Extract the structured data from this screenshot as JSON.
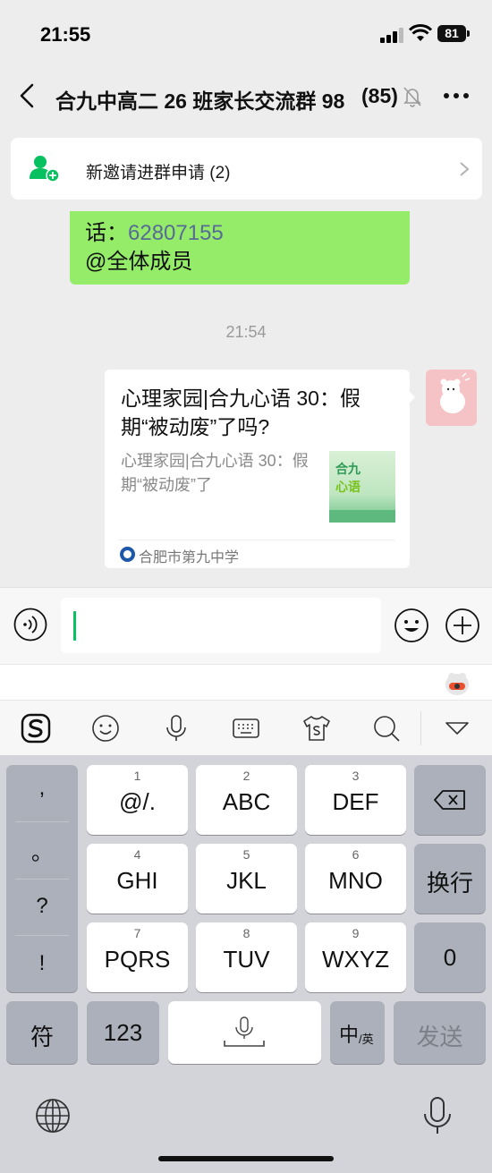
{
  "status_bar": {
    "time": "21:55",
    "battery": "81"
  },
  "nav": {
    "title": "合九中高二 26 班家长交流群 98",
    "member_count": "(85)"
  },
  "invite_banner": {
    "label": "新邀请进群申请 (2)"
  },
  "messages": {
    "previous_bubble": {
      "prefix": "话：",
      "phone": "62807155",
      "mention": "@全体成员"
    },
    "timestamp": "21:54",
    "shared_card": {
      "title": "心理家园|合九心语 30：假期“被动废”了吗?",
      "description": "心理家园|合九心语 30：假期“被动废”了",
      "thumbnail_line1": "合九",
      "thumbnail_line2": "心语",
      "source": "合肥市第九中学"
    }
  },
  "ime": {
    "toolbar_icons": [
      "sogou-logo-icon",
      "emoji-icon",
      "voice-input-icon",
      "keyboard-layout-icon",
      "skin-icon",
      "search-icon",
      "collapse-icon"
    ],
    "punctuation": [
      ",",
      "。",
      "?",
      "!"
    ],
    "keys": [
      {
        "num": "1",
        "label": "@/."
      },
      {
        "num": "2",
        "label": "ABC"
      },
      {
        "num": "3",
        "label": "DEF"
      },
      {
        "num": "4",
        "label": "GHI"
      },
      {
        "num": "5",
        "label": "JKL"
      },
      {
        "num": "6",
        "label": "MNO"
      },
      {
        "num": "7",
        "label": "PQRS"
      },
      {
        "num": "8",
        "label": "TUV"
      },
      {
        "num": "9",
        "label": "WXYZ"
      }
    ],
    "newline_label": "换行",
    "zero_label": "0",
    "symbol_label": "符",
    "numeric_label": "123",
    "lang_main": "中",
    "lang_sub": "/英",
    "send_label": "发送"
  },
  "colors": {
    "accent": "#07c160",
    "bubble_green": "#95ec69",
    "link_blue": "#576b95"
  }
}
